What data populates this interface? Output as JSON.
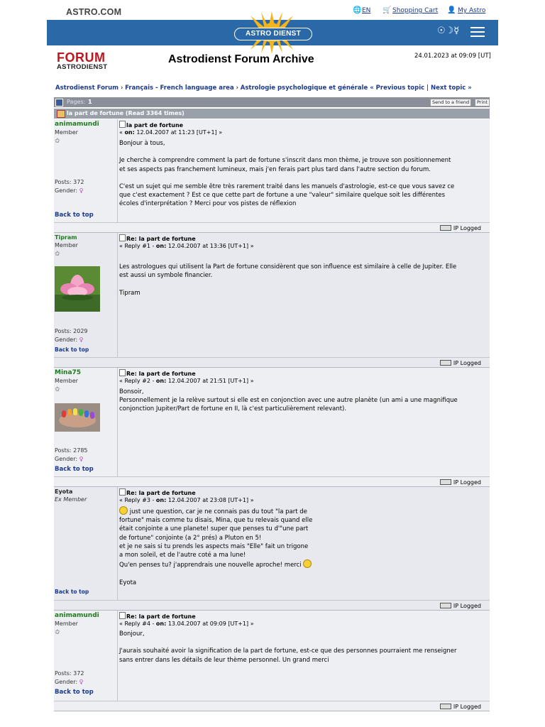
{
  "header": {
    "brand": "ASTRO.COM",
    "lang": "EN",
    "cart": "Shopping Cart",
    "account": "My Astro",
    "logo_text": "ASTRO DIENST",
    "symbols": "☉☽☿"
  },
  "forum_logo": {
    "line1": "FORUM",
    "line2": "ASTRODIENST"
  },
  "archive_title": "Astrodienst Forum Archive",
  "datestamp": "24.01.2023 at 09:09 [UT]",
  "breadcrumb": {
    "items": [
      "Astrodienst Forum",
      "Français - French language area",
      "Astrologie psychologique et générale"
    ],
    "prev": "« Previous topic",
    "sep": "|",
    "next": "Next topic »"
  },
  "pages": {
    "label": "Pages:",
    "current": "1",
    "send_label": "Send to a friend",
    "print_label": "Print"
  },
  "topic": {
    "title": "la part de fortune  (Read 3364 times)"
  },
  "ip_label": "IP Logged",
  "back_to_top": "Back to top",
  "posts": [
    {
      "user": "animamundi",
      "rank": "Member",
      "stars": "✩",
      "posts": "Posts: 372",
      "gender": "Gender:",
      "title": "la part de fortune",
      "meta_prefix": "« ",
      "meta_on": "on:",
      "meta_date": " 12.04.2007 at 11:23 [UT+1] »",
      "text": "Bonjour à tous,\n\nJe cherche à comprendre comment la part de fortune s'inscrit dans mon thème, je trouve son positionnement\net ses aspects pas franchement lumineux, mais j'en ferais part plus tard dans l'autre section du forum.\n\n C'est un sujet qui me semble être très rarement traité dans les manuels d'astrologie, est-ce que vous savez ce\nque c'est exactement ? Est ce que cette part de fortune a une \"valeur\" similaire quelque soit les différentes\nécoles d'interprétation ? Merci pour vos pistes de réflexion"
    },
    {
      "user": "Tipram",
      "rank": "Member",
      "stars": "✩",
      "posts": "Posts: 2029",
      "gender": "Gender:",
      "title": "Re: la part de fortune",
      "meta_prefix": "« Reply #1 - ",
      "meta_on": "on:",
      "meta_date": " 12.04.2007 at 13:36 [UT+1] »",
      "text": "Les astrologues qui utilisent la Part de fortune considèrent que son influence est similaire à celle de Jupiter. Elle\nest aussi un symbole financier.\n\nTipram"
    },
    {
      "user": "Mina75",
      "rank": "Member",
      "stars": "✩",
      "posts": "Posts: 2785",
      "gender": "Gender:",
      "title": "Re: la part de fortune",
      "meta_prefix": "« Reply #2 - ",
      "meta_on": "on:",
      "meta_date": " 12.04.2007 at 21:51 [UT+1] »",
      "text": "Bonsoir,\nPersonnellement je la relève surtout si elle est en conjonction avec une autre planète (un ami a une magnifique\nconjonction Jupiter/Part de fortune en II, là c'est particulièrement relevant)."
    },
    {
      "user": "Eyota",
      "rank": "Ex Member",
      "title": "Re: la part de fortune",
      "meta_prefix": "« Reply #3 - ",
      "meta_on": "on:",
      "meta_date": " 12.04.2007 at 23:08 [UT+1] »",
      "line1": " just une question, car je ne connais pas du tout \"la part de",
      "text_mid": "fortune\" mais comme tu disais, Mina, que tu relevais quand elle\nétait conjointe a une planete! super que penses tu d'\"une part\nde fortune\" conjointe (a 2° prés) a Pluton en 5!\net je ne sais si tu prends les aspects mais \"Elle\" fait un trigone\na mon soleil, et de l'autre coté a ma lune!",
      "line_end": "Qu'en penses tu? j'apprendrais une nouvelle aproche! merci ",
      "sign": "Eyota"
    },
    {
      "user": "animamundi",
      "rank": "Member",
      "stars": "✩",
      "posts": "Posts: 372",
      "gender": "Gender:",
      "title": "Re: la part de fortune",
      "meta_prefix": "« Reply #4 - ",
      "meta_on": "on:",
      "meta_date": " 13.04.2007 at 09:09 [UT+1] »",
      "text": "Bonjour,\n\nJ'aurais souhaité avoir la signification de la part de fortune, est-ce que des personnes pourraient me renseigner\nsans entrer dans les détails de leur thème personnel. Un grand merci"
    }
  ]
}
